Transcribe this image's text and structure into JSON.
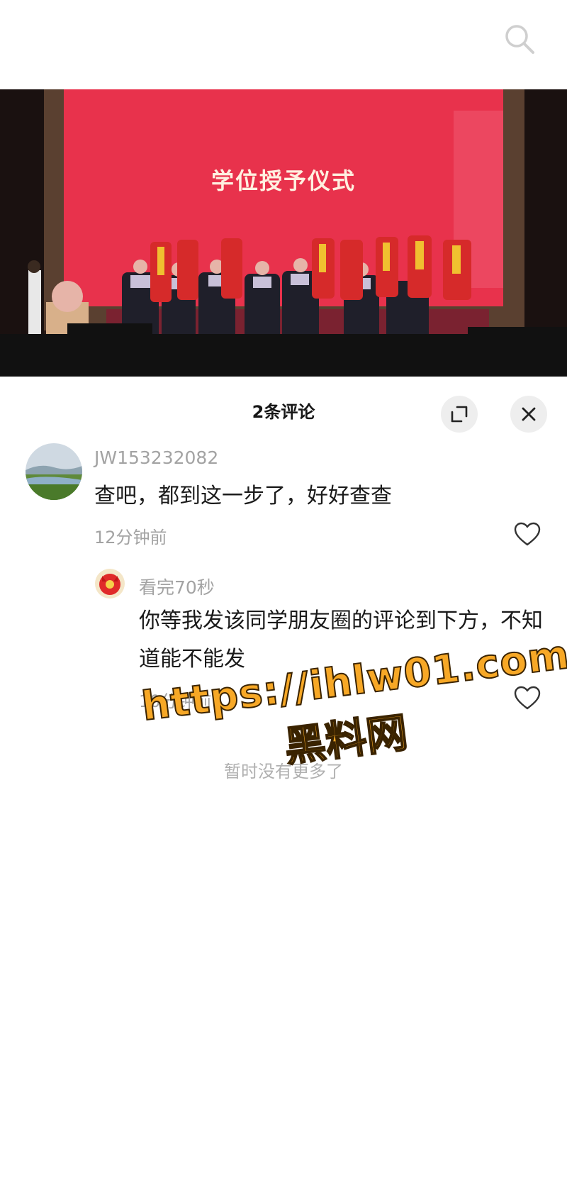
{
  "video": {
    "screen_title": "学位授予仪式"
  },
  "comments_panel": {
    "title": "2条评论",
    "comments": [
      {
        "username": "JW153232082",
        "text": "查吧，都到这一步了，好好查查",
        "time": "12分钟前"
      },
      {
        "username": "看完70秒",
        "text": "你等我发该同学朋友圈的评论到下方，不知道能不能发",
        "time": "10分钟前"
      }
    ],
    "end_text": "暂时没有更多了"
  },
  "watermark": {
    "line1": "https://ihlw01.com",
    "line2": "黑料网"
  },
  "icons": {
    "search": "search-icon",
    "expand": "expand-icon",
    "close": "close-icon",
    "like": "heart-icon"
  },
  "colors": {
    "stage_red": "#e8324c",
    "watermark_orange": "#f7a826",
    "muted_text": "#a3a3a3"
  }
}
